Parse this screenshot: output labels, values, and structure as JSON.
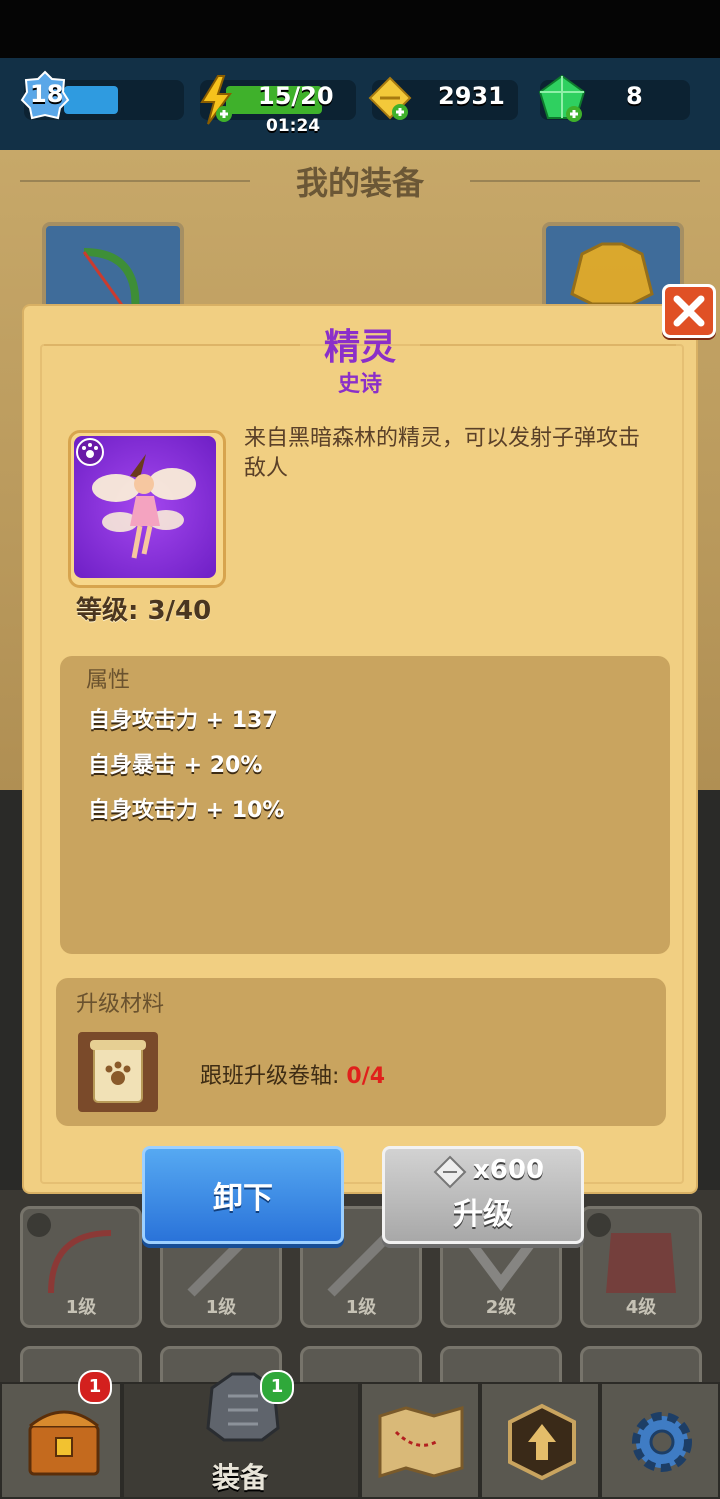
{
  "topbar": {
    "level": "18",
    "energy": "15/20",
    "timer": "01:24",
    "gold": "2931",
    "gems": "8"
  },
  "background": {
    "title": "我的装备",
    "grid_levels": [
      "1级",
      "1级",
      "1级",
      "2级",
      "4级"
    ]
  },
  "modal": {
    "title": "精灵",
    "rarity": "史诗",
    "description": "来自黑暗森林的精灵，可以发射子弹攻击敌人",
    "level_label": "等级: 3/40",
    "attributes_title": "属性",
    "attributes": [
      "自身攻击力 + 137",
      "自身暴击 + 20%",
      "自身攻击力 + 10%"
    ],
    "materials_title": "升级材料",
    "material_name": "跟班升级卷轴: ",
    "material_count": "0/4",
    "unequip_label": "卸下",
    "upgrade_cost": "x600",
    "upgrade_label": "升级"
  },
  "nav": {
    "chest_badge": "1",
    "equip_badge": "1",
    "equip_label": "装备"
  },
  "colors": {
    "epic_purple": "#8b2fc9",
    "panel": "#f1cf82",
    "blue_button": "#2a73d9",
    "grey_button": "#a8a8a8",
    "count_red": "#e0201c"
  }
}
